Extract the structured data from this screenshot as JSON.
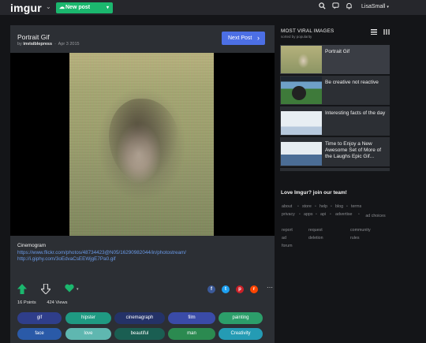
{
  "topbar": {
    "logo": "imgur",
    "new_post": "New post",
    "username": "LisaSmall",
    "icons": [
      "search-icon",
      "chat-icon",
      "bell-icon"
    ]
  },
  "post": {
    "title": "Portrait Gif",
    "by": "by",
    "author": "invisiblepress",
    "date": "Apr 3 2015",
    "next_post": "Next Post",
    "description": {
      "heading": "Cinemogram",
      "link1": "https://www.flickr.com/photos/48734423@N05/16290982044/in/photostream/",
      "link2": "http://i.giphy.com/3oEdvaCsEEWjgE7Pa0.gif"
    },
    "points": "16 Points",
    "views": "424 Views",
    "share_icons": [
      {
        "name": "facebook-icon",
        "glyph": "f",
        "color": "#3b5998"
      },
      {
        "name": "twitter-icon",
        "glyph": "t",
        "color": "#1da1f2"
      },
      {
        "name": "pinterest-icon",
        "glyph": "p",
        "color": "#cb2027"
      },
      {
        "name": "reddit-icon",
        "glyph": "r",
        "color": "#ff4500"
      }
    ],
    "tags": [
      {
        "label": "gif",
        "color": "#2f3e8a"
      },
      {
        "label": "hipster",
        "color": "#1f9a82"
      },
      {
        "label": "cinemagraph",
        "color": "#243267"
      },
      {
        "label": "film",
        "color": "#3a4ba8"
      },
      {
        "label": "painting",
        "color": "#2c9e6a"
      },
      {
        "label": "face",
        "color": "#2a5aa8"
      },
      {
        "label": "love",
        "color": "#5fb7b0"
      },
      {
        "label": "beautiful",
        "color": "#1a5e52"
      },
      {
        "label": "man",
        "color": "#2b8a50"
      },
      {
        "label": "Creativity",
        "color": "#249bb4"
      }
    ]
  },
  "sidebar": {
    "title": "MOST VIRAL IMAGES",
    "subtitle": "sorted by popularity",
    "items": [
      {
        "label": "Portrait Gif"
      },
      {
        "label": "Be creative not reactive"
      },
      {
        "label": "Interesting facts of the day"
      },
      {
        "label": "Time to Enjoy a New Awesome Set of More of the Laughs Epic Gif..."
      }
    ],
    "join": "Love Imgur? join our team!",
    "footer_links": [
      "about",
      "store",
      "help",
      "blog",
      "terms",
      "privacy",
      "apps",
      "api",
      "advertise",
      "ad choices",
      "report",
      "request",
      "community",
      "ad",
      "deletion",
      "rules",
      "forum"
    ]
  }
}
